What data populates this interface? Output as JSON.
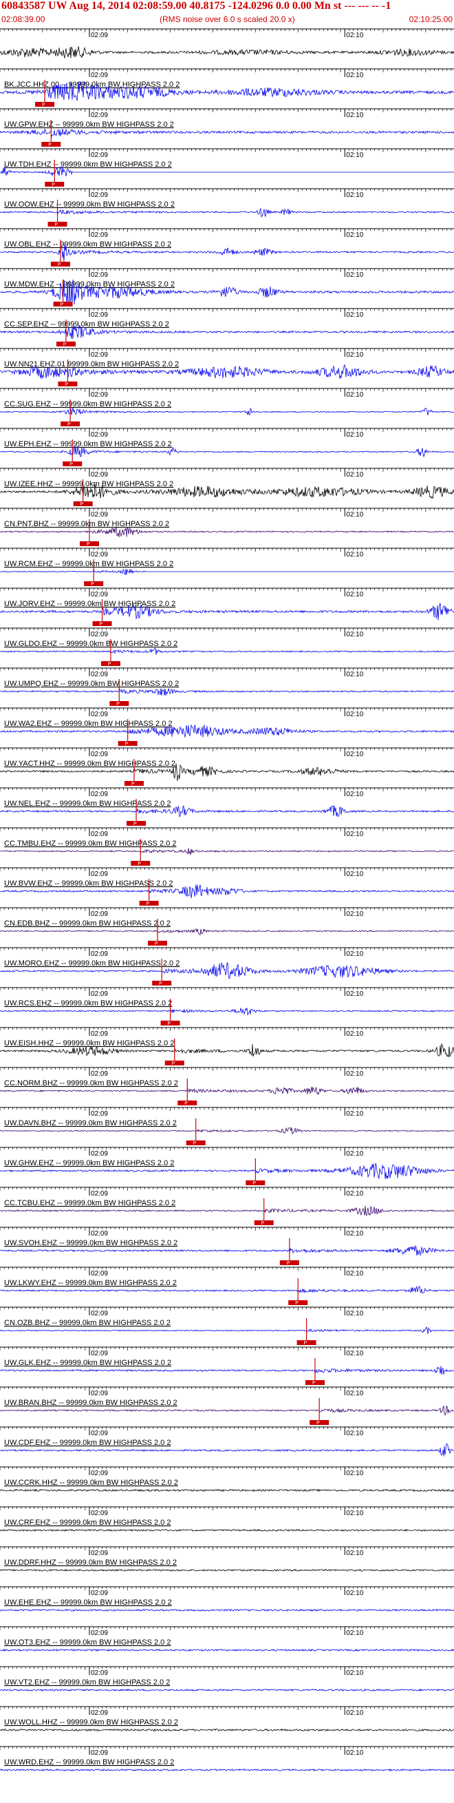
{
  "header": {
    "title": "60843587 UW Aug 14, 2014 02:08:59.00  40.8175 -124.0296  0.0 0.00 Mn st --- --- --  -1",
    "start_time": "02:08:39.00",
    "noise_note": "(RMS noise over 6.0 s scaled 20.0 x)",
    "end_time": "02:10:25.00"
  },
  "chart_data": {
    "type": "seismogram",
    "time_axis": {
      "start": "02:08:39.00",
      "end": "02:10:25.00",
      "tick_labels": [
        "02:09",
        "02:10"
      ]
    },
    "colors": {
      "blue": "#0000ee",
      "black": "#000000",
      "purple": "#330066",
      "pick": "#cc0000"
    },
    "traces": [
      {
        "label": "",
        "pick": "",
        "color": "black",
        "amp": 0.55,
        "bursts": [
          [
            0.06,
            0.05,
            1.2
          ],
          [
            0.16,
            0.04,
            1.6
          ],
          [
            0.55,
            0.1,
            0.5
          ],
          [
            0.9,
            0.06,
            0.8
          ]
        ],
        "first_arrival_s": null
      },
      {
        "label": "BK.JCC.HHZ.00 -- 99999.0km BW HIGHPASS  2.0  2",
        "pick": "P",
        "color": "blue",
        "amp": 0.7,
        "bursts": [
          [
            0.17,
            0.06,
            1.8
          ],
          [
            0.3,
            0.08,
            1.2
          ],
          [
            0.6,
            0.1,
            0.8
          ]
        ],
        "first_arrival_s": 10.5
      },
      {
        "label": "UW.GPW.EHZ -- 99999.0km BW HIGHPASS  2.0  2",
        "pick": "P",
        "color": "blue",
        "amp": 0.55,
        "bursts": [
          [
            0.1,
            0.04,
            0.6
          ]
        ],
        "first_arrival_s": 12.0
      },
      {
        "label": "UW.TDH.EHZ -- 99999.0km BW HIGHPASS  2.0  2",
        "pick": "P",
        "color": "blue",
        "amp": 0.3,
        "bursts": [
          [
            0.01,
            0.01,
            3.0
          ],
          [
            0.13,
            0.02,
            2.5
          ]
        ],
        "first_arrival_s": 12.8,
        "flatline_after": 0.14
      },
      {
        "label": "UW.OOW.EHZ -- 99999.0km BW HIGHPASS  2.0  2",
        "pick": "P",
        "color": "blue",
        "amp": 0.35,
        "bursts": [
          [
            0.58,
            0.01,
            2.5
          ],
          [
            0.63,
            0.01,
            1.5
          ]
        ],
        "first_arrival_s": 13.5
      },
      {
        "label": "UW.OBL.EHZ -- 99999.0km BW HIGHPASS  2.0  2",
        "pick": "P",
        "color": "blue",
        "amp": 0.4,
        "bursts": [
          [
            0.14,
            0.01,
            3.5
          ],
          [
            0.5,
            0.02,
            1.5
          ],
          [
            0.58,
            0.02,
            1.4
          ]
        ],
        "first_arrival_s": 14.2
      },
      {
        "label": "UW.MDW.EHZ -- 99999.0km BW HIGHPASS  2.0  2",
        "pick": "P",
        "color": "blue",
        "amp": 0.55,
        "bursts": [
          [
            0.15,
            0.03,
            3.0
          ],
          [
            0.25,
            0.08,
            1.4
          ],
          [
            0.5,
            0.02,
            1.6
          ],
          [
            0.59,
            0.02,
            1.5
          ]
        ],
        "first_arrival_s": 14.8
      },
      {
        "label": "CC.SEP.EHZ -- 99999.0km BW HIGHPASS  2.0  2",
        "pick": "P",
        "color": "blue",
        "amp": 0.45,
        "bursts": [
          [
            0.17,
            0.03,
            1.8
          ]
        ],
        "first_arrival_s": 15.5
      },
      {
        "label": "UW.NN21.EHZ.01 99999.0km BW HIGHPASS  2.0  2",
        "pick": "P",
        "color": "blue",
        "amp": 0.6,
        "bursts": [
          [
            0.1,
            0.05,
            1.5
          ],
          [
            0.5,
            0.08,
            1.4
          ],
          [
            0.75,
            0.05,
            1.6
          ],
          [
            0.95,
            0.03,
            1.4
          ]
        ],
        "first_arrival_s": 15.9
      },
      {
        "label": "CC.SUG.EHZ -- 99999.0km BW HIGHPASS  2.0  2",
        "pick": "P",
        "color": "blue",
        "amp": 0.25,
        "bursts": [
          [
            0.16,
            0.02,
            2.0
          ],
          [
            0.55,
            0.01,
            2.5
          ],
          [
            0.94,
            0.01,
            2.5
          ]
        ],
        "first_arrival_s": 16.5
      },
      {
        "label": "UW.EPH.EHZ -- 99999.0km BW HIGHPASS  2.0  2",
        "pick": "P",
        "color": "blue",
        "amp": 0.3,
        "bursts": [
          [
            0.17,
            0.02,
            2.5
          ],
          [
            0.38,
            0.01,
            2.0
          ],
          [
            0.93,
            0.01,
            3.0
          ]
        ],
        "first_arrival_s": 17.0
      },
      {
        "label": "UW.IZEE.HHZ -- 99999.0km BW HIGHPASS  2.0  2",
        "pick": "P",
        "color": "black",
        "amp": 0.5,
        "bursts": [
          [
            0.2,
            0.04,
            2.0
          ],
          [
            0.45,
            0.08,
            1.6
          ],
          [
            0.7,
            0.1,
            1.5
          ],
          [
            0.95,
            0.04,
            1.8
          ]
        ],
        "first_arrival_s": 19.5
      },
      {
        "label": "CN.PNT.BHZ -- 99999.0km BW HIGHPASS  2.0  2",
        "pick": "P",
        "color": "purple",
        "amp": 0.3,
        "bursts": [
          [
            0.27,
            0.03,
            2.5
          ]
        ],
        "first_arrival_s": 21.0
      },
      {
        "label": "UW.RCM.EHZ -- 99999.0km BW HIGHPASS  2.0  2",
        "pick": "P",
        "color": "blue",
        "amp": 0.2,
        "bursts": [
          [
            0.28,
            0.01,
            2.5
          ],
          [
            0.87,
            0.01,
            3.5
          ]
        ],
        "first_arrival_s": 22.0,
        "flatline_after": 0.3
      },
      {
        "label": "UW.JORV.EHZ -- 99999.0km BW HIGHPASS  2.0  2",
        "pick": "P",
        "color": "blue",
        "amp": 0.55,
        "bursts": [
          [
            0.3,
            0.04,
            1.5
          ],
          [
            0.97,
            0.02,
            2.5
          ]
        ],
        "first_arrival_s": 24.0
      },
      {
        "label": "UW.GLDO.EHZ -- 99999.0km BW HIGHPASS  2.0  2",
        "pick": "P",
        "color": "blue",
        "amp": 0.3,
        "bursts": [
          [
            0.34,
            0.01,
            1.5
          ]
        ],
        "first_arrival_s": 26.0
      },
      {
        "label": "UW.UMPQ.EHZ -- 99999.0km BW HIGHPASS  2.0  2",
        "pick": "P",
        "color": "blue",
        "amp": 0.35,
        "bursts": [
          [
            0.36,
            0.02,
            1.6
          ]
        ],
        "first_arrival_s": 28.0
      },
      {
        "label": "UW.WA2.EHZ -- 99999.0km BW HIGHPASS  2.0  2",
        "pick": "P",
        "color": "blue",
        "amp": 0.45,
        "bursts": [
          [
            0.42,
            0.08,
            2.0
          ],
          [
            0.6,
            0.05,
            1.3
          ]
        ],
        "first_arrival_s": 30.0
      },
      {
        "label": "UW.YACT.HHZ -- 99999.0km BW HIGHPASS  2.0  2",
        "pick": "P",
        "color": "black",
        "amp": 0.45,
        "bursts": [
          [
            0.39,
            0.01,
            3.0
          ],
          [
            0.45,
            0.03,
            1.5
          ],
          [
            0.7,
            0.04,
            1.3
          ]
        ],
        "first_arrival_s": 31.5
      },
      {
        "label": "UW.NEL.EHZ -- 99999.0km BW HIGHPASS  2.0  2",
        "pick": "P",
        "color": "blue",
        "amp": 0.4,
        "bursts": [
          [
            0.4,
            0.02,
            1.8
          ],
          [
            0.74,
            0.02,
            2.2
          ]
        ],
        "first_arrival_s": 32.0
      },
      {
        "label": "CC.TMBU.EHZ -- 99999.0km BW HIGHPASS  2.0  2",
        "pick": "P",
        "color": "purple",
        "amp": 0.3,
        "bursts": [
          [
            0.42,
            0.01,
            1.5
          ]
        ],
        "first_arrival_s": 33.0
      },
      {
        "label": "UW.BVW.EHZ -- 99999.0km BW HIGHPASS  2.0  2",
        "pick": "P",
        "color": "blue",
        "amp": 0.4,
        "bursts": [
          [
            0.43,
            0.03,
            2.5
          ],
          [
            0.5,
            0.03,
            1.3
          ]
        ],
        "first_arrival_s": 35.0
      },
      {
        "label": "CN.EDB.BHZ -- 99999.0km BW HIGHPASS  2.0  2",
        "pick": "P",
        "color": "purple",
        "amp": 0.3,
        "bursts": [
          [
            0.44,
            0.01,
            1.5
          ]
        ],
        "first_arrival_s": 37.0
      },
      {
        "label": "UW.MORO.EHZ -- 99999.0km BW HIGHPASS  2.0  2",
        "pick": "P",
        "color": "blue",
        "amp": 0.4,
        "bursts": [
          [
            0.5,
            0.05,
            3.0
          ],
          [
            0.75,
            0.08,
            2.4
          ]
        ],
        "first_arrival_s": 38.0
      },
      {
        "label": "UW.RCS.EHZ -- 99999.0km BW HIGHPASS  2.0  2",
        "pick": "P",
        "color": "blue",
        "amp": 0.3,
        "bursts": [
          [
            0.54,
            0.02,
            2.0
          ]
        ],
        "first_arrival_s": 40.0
      },
      {
        "label": "UW.EISH.HHZ -- 99999.0km BW HIGHPASS  2.0  2",
        "pick": "P",
        "color": "black",
        "amp": 0.45,
        "bursts": [
          [
            0.2,
            0.05,
            1.5
          ],
          [
            0.56,
            0.01,
            3.0
          ],
          [
            0.98,
            0.02,
            2.5
          ]
        ],
        "first_arrival_s": 41.0
      },
      {
        "label": "CC.NORM.BHZ -- 99999.0km BW HIGHPASS  2.0  2",
        "pick": "P",
        "color": "purple",
        "amp": 0.35,
        "bursts": [
          [
            0.62,
            0.02,
            2.0
          ],
          [
            0.69,
            0.02,
            2.0
          ],
          [
            0.78,
            0.02,
            1.8
          ]
        ],
        "first_arrival_s": 44.0
      },
      {
        "label": "UW.DAVN.BHZ -- 99999.0km BW HIGHPASS  2.0  2",
        "pick": "P",
        "color": "purple",
        "amp": 0.25,
        "bursts": [
          [
            0.64,
            0.02,
            2.0
          ]
        ],
        "first_arrival_s": 46.0
      },
      {
        "label": "UW.GHW.EHZ -- 99999.0km BW HIGHPASS  2.0  2",
        "pick": "P",
        "color": "blue",
        "amp": 0.4,
        "bursts": [
          [
            0.85,
            0.08,
            3.0
          ]
        ],
        "first_arrival_s": 60.0
      },
      {
        "label": "CC.TCBU.EHZ -- 99999.0km BW HIGHPASS  2.0  2",
        "pick": "P",
        "color": "purple",
        "amp": 0.35,
        "bursts": [
          [
            0.81,
            0.03,
            2.0
          ]
        ],
        "first_arrival_s": 62.0
      },
      {
        "label": "UW.SVOH.EHZ -- 99999.0km BW HIGHPASS  2.0  2",
        "pick": "P",
        "color": "blue",
        "amp": 0.4,
        "bursts": [
          [
            0.91,
            0.04,
            1.8
          ]
        ],
        "first_arrival_s": 68.0
      },
      {
        "label": "UW.LKWY.EHZ -- 99999.0km BW HIGHPASS  2.0  2",
        "pick": "P",
        "color": "blue",
        "amp": 0.35,
        "bursts": [
          [
            0.92,
            0.02,
            1.8
          ]
        ],
        "first_arrival_s": 70.0
      },
      {
        "label": "CN.OZB.BHZ -- 99999.0km BW HIGHPASS  2.0  2",
        "pick": "P",
        "color": "blue",
        "amp": 0.25,
        "bursts": [
          [
            0.94,
            0.01,
            2.0
          ]
        ],
        "first_arrival_s": 72.0
      },
      {
        "label": "UW.GLK.EHZ -- 99999.0km BW HIGHPASS  2.0  2",
        "pick": "P",
        "color": "blue",
        "amp": 0.4,
        "bursts": [
          [
            0.97,
            0.01,
            2.5
          ]
        ],
        "first_arrival_s": 74.0
      },
      {
        "label": "UW.BRAN.BHZ -- 99999.0km BW HIGHPASS  2.0  2",
        "pick": "P",
        "color": "purple",
        "amp": 0.35,
        "bursts": [
          [
            0.98,
            0.01,
            2.0
          ]
        ],
        "first_arrival_s": 75.0
      },
      {
        "label": "UW.CDF.EHZ -- 99999.0km BW HIGHPASS  2.0  2",
        "pick": "",
        "color": "blue",
        "amp": 0.4,
        "bursts": [
          [
            0.98,
            0.01,
            3.0
          ]
        ],
        "first_arrival_s": null
      },
      {
        "label": "UW.CCRK.HHZ -- 99999.0km BW HIGHPASS  2.0  2",
        "pick": "",
        "color": "black",
        "amp": 0.45,
        "bursts": [],
        "first_arrival_s": null
      },
      {
        "label": "UW.CRF.EHZ -- 99999.0km BW HIGHPASS  2.0  2",
        "pick": "",
        "color": "black",
        "amp": 0.4,
        "bursts": [],
        "first_arrival_s": null
      },
      {
        "label": "UW.DDRF.HHZ -- 99999.0km BW HIGHPASS  2.0  2",
        "pick": "",
        "color": "black",
        "amp": 0.4,
        "bursts": [],
        "first_arrival_s": null
      },
      {
        "label": "UW.EHE.EHZ -- 99999.0km BW HIGHPASS  2.0  2",
        "pick": "",
        "color": "blue",
        "amp": 0.4,
        "bursts": [],
        "first_arrival_s": null
      },
      {
        "label": "UW.OT3.EHZ -- 99999.0km BW HIGHPASS  2.0  2",
        "pick": "",
        "color": "blue",
        "amp": 0.4,
        "bursts": [],
        "first_arrival_s": null
      },
      {
        "label": "UW.VT2.EHZ -- 99999.0km BW HIGHPASS  2.0  2",
        "pick": "",
        "color": "blue",
        "amp": 0.4,
        "bursts": [],
        "first_arrival_s": null
      },
      {
        "label": "UW.WOLL.HHZ -- 99999.0km BW HIGHPASS  2.0  2",
        "pick": "",
        "color": "black",
        "amp": 0.45,
        "bursts": [],
        "first_arrival_s": null
      },
      {
        "label": "UW.WRD.EHZ -- 99999.0km BW HIGHPASS  2.0  2",
        "pick": "",
        "color": "blue",
        "amp": 0.4,
        "bursts": [],
        "first_arrival_s": null
      }
    ]
  }
}
